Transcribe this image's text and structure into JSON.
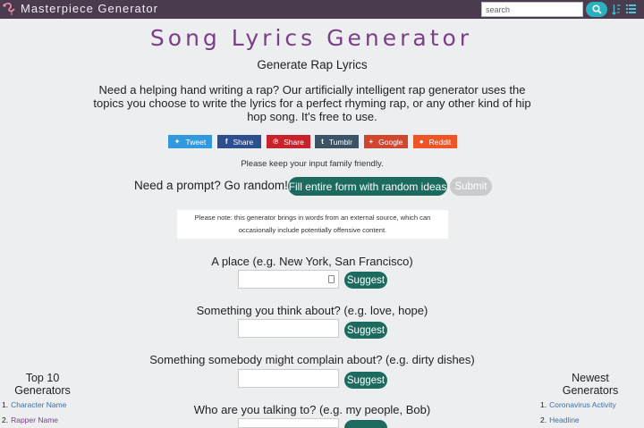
{
  "header": {
    "brand": "Masterpiece Generator",
    "search_placeholder": "search",
    "icons": [
      "flamingo-logo-icon",
      "search-icon",
      "sort-icon",
      "list-icon"
    ]
  },
  "main": {
    "title": "Song Lyrics Generator",
    "subtitle": "Generate Rap Lyrics",
    "intro": "Need a helping hand writing a rap? Our artificially intelligent rap generator uses the topics you choose to write the lyrics for a perfect rhyming rap, or any other kind of hip hop song. It's free to use.",
    "share_buttons": [
      {
        "label": "Tweet",
        "icon": "twitter-icon",
        "color": "#3399dd"
      },
      {
        "label": "Share",
        "icon": "facebook-icon",
        "color": "#2d4f8d"
      },
      {
        "label": "Share",
        "icon": "pinterest-icon",
        "color": "#c8232c"
      },
      {
        "label": "Tumblr",
        "icon": "tumblr-icon",
        "color": "#3c5366"
      },
      {
        "label": "Google",
        "icon": "google-plus-icon",
        "color": "#d0462f"
      },
      {
        "label": "Reddit",
        "icon": "reddit-icon",
        "color": "#ee5526"
      }
    ],
    "family_note": "Please keep your input family friendly.",
    "prompt_text": "Need a prompt? Go random!",
    "random_button": "Fill entire form with random ideas",
    "submit_button": "Submit",
    "external_note": "Please note: this generator brings in words from an external source, which can occasionally include potentially offensive content.",
    "suggest_label": "Suggest",
    "questions": [
      {
        "label": "A place (e.g. New York, San Francisco)",
        "value": ""
      },
      {
        "label": "Something you think about? (e.g. love, hope)",
        "value": ""
      },
      {
        "label": "Something somebody might complain about? (e.g. dirty dishes)",
        "value": ""
      },
      {
        "label": "Who are you talking to? (e.g. my people, Bob)",
        "value": ""
      }
    ]
  },
  "left_sidebar": {
    "title": "Top 10 Generators",
    "items": [
      "Character Name",
      "Rapper Name"
    ]
  },
  "right_sidebar": {
    "title": "Newest Generators",
    "items": [
      "Coronavirus Activity",
      "Headline"
    ]
  },
  "colors": {
    "topbar": "#4a3b4f",
    "title": "#7b3f86",
    "primary_button": "#1d6b5f",
    "search_button": "#2bb0c0",
    "disabled_button": "#c9cbcc"
  }
}
